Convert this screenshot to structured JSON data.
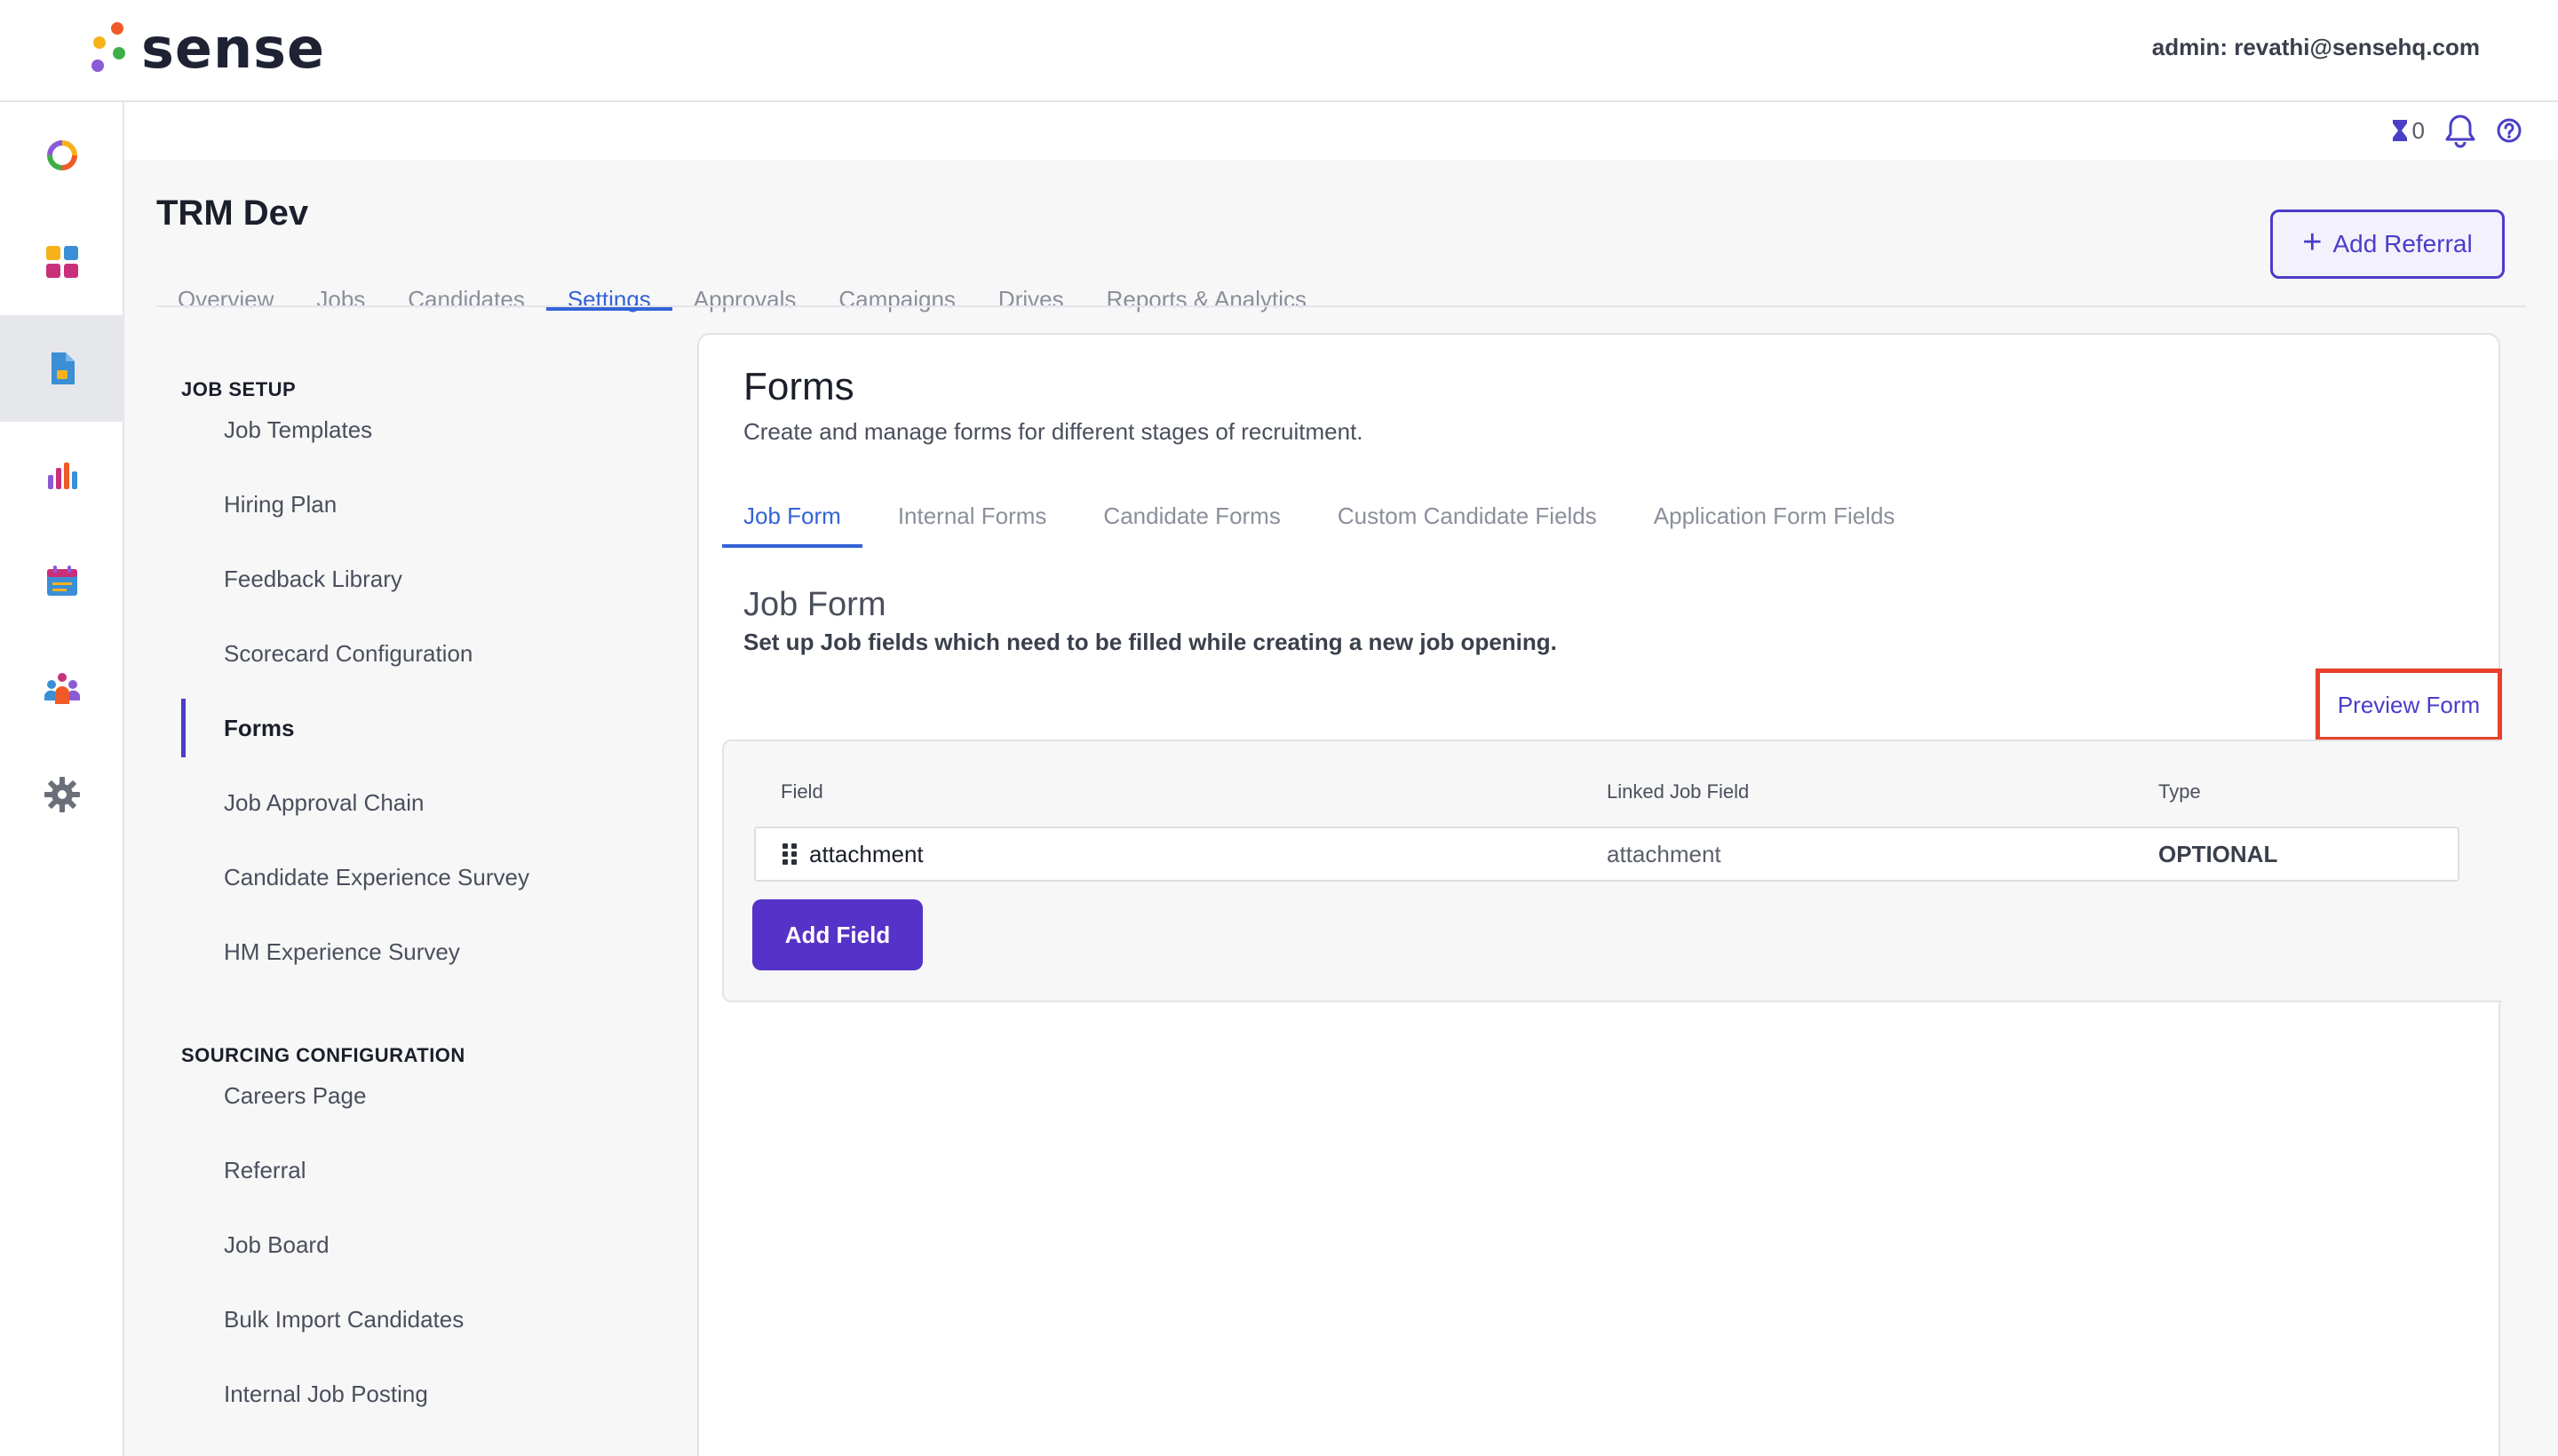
{
  "app": {
    "brand": "sense",
    "admin_label": "admin: revathi@sensehq.com"
  },
  "header_icons": {
    "pending_count": "0"
  },
  "page": {
    "org_title": "TRM Dev",
    "add_referral_label": "Add Referral",
    "tabs": [
      {
        "label": "Overview"
      },
      {
        "label": "Jobs"
      },
      {
        "label": "Candidates"
      },
      {
        "label": "Settings"
      },
      {
        "label": "Approvals"
      },
      {
        "label": "Campaigns"
      },
      {
        "label": "Drives"
      },
      {
        "label": "Reports & Analytics"
      }
    ]
  },
  "settings_nav": {
    "job_setup_heading": "JOB SETUP",
    "job_setup_items": [
      {
        "label": "Job Templates"
      },
      {
        "label": "Hiring Plan"
      },
      {
        "label": "Feedback Library"
      },
      {
        "label": "Scorecard Configuration"
      },
      {
        "label": "Forms"
      },
      {
        "label": "Job Approval Chain"
      },
      {
        "label": "Candidate Experience Survey"
      },
      {
        "label": "HM Experience Survey"
      }
    ],
    "sourcing_heading": "SOURCING CONFIGURATION",
    "sourcing_items": [
      {
        "label": "Careers Page"
      },
      {
        "label": "Referral"
      },
      {
        "label": "Job Board"
      },
      {
        "label": "Bulk Import Candidates"
      },
      {
        "label": "Internal Job Posting"
      }
    ]
  },
  "forms": {
    "title": "Forms",
    "subtitle": "Create and manage forms for different stages of recruitment.",
    "tabs": [
      {
        "label": "Job Form"
      },
      {
        "label": "Internal Forms"
      },
      {
        "label": "Candidate Forms"
      },
      {
        "label": "Custom Candidate Fields"
      },
      {
        "label": "Application Form Fields"
      }
    ],
    "section_title": "Job Form",
    "section_subtitle": "Set up Job fields which need to be filled while creating a new job opening.",
    "preview_label": "Preview Form",
    "table": {
      "headers": [
        "Field",
        "Linked Job Field",
        "Type"
      ],
      "rows": [
        {
          "field": "attachment",
          "linked": "attachment",
          "type": "OPTIONAL"
        }
      ]
    },
    "add_field_label": "Add Field"
  }
}
